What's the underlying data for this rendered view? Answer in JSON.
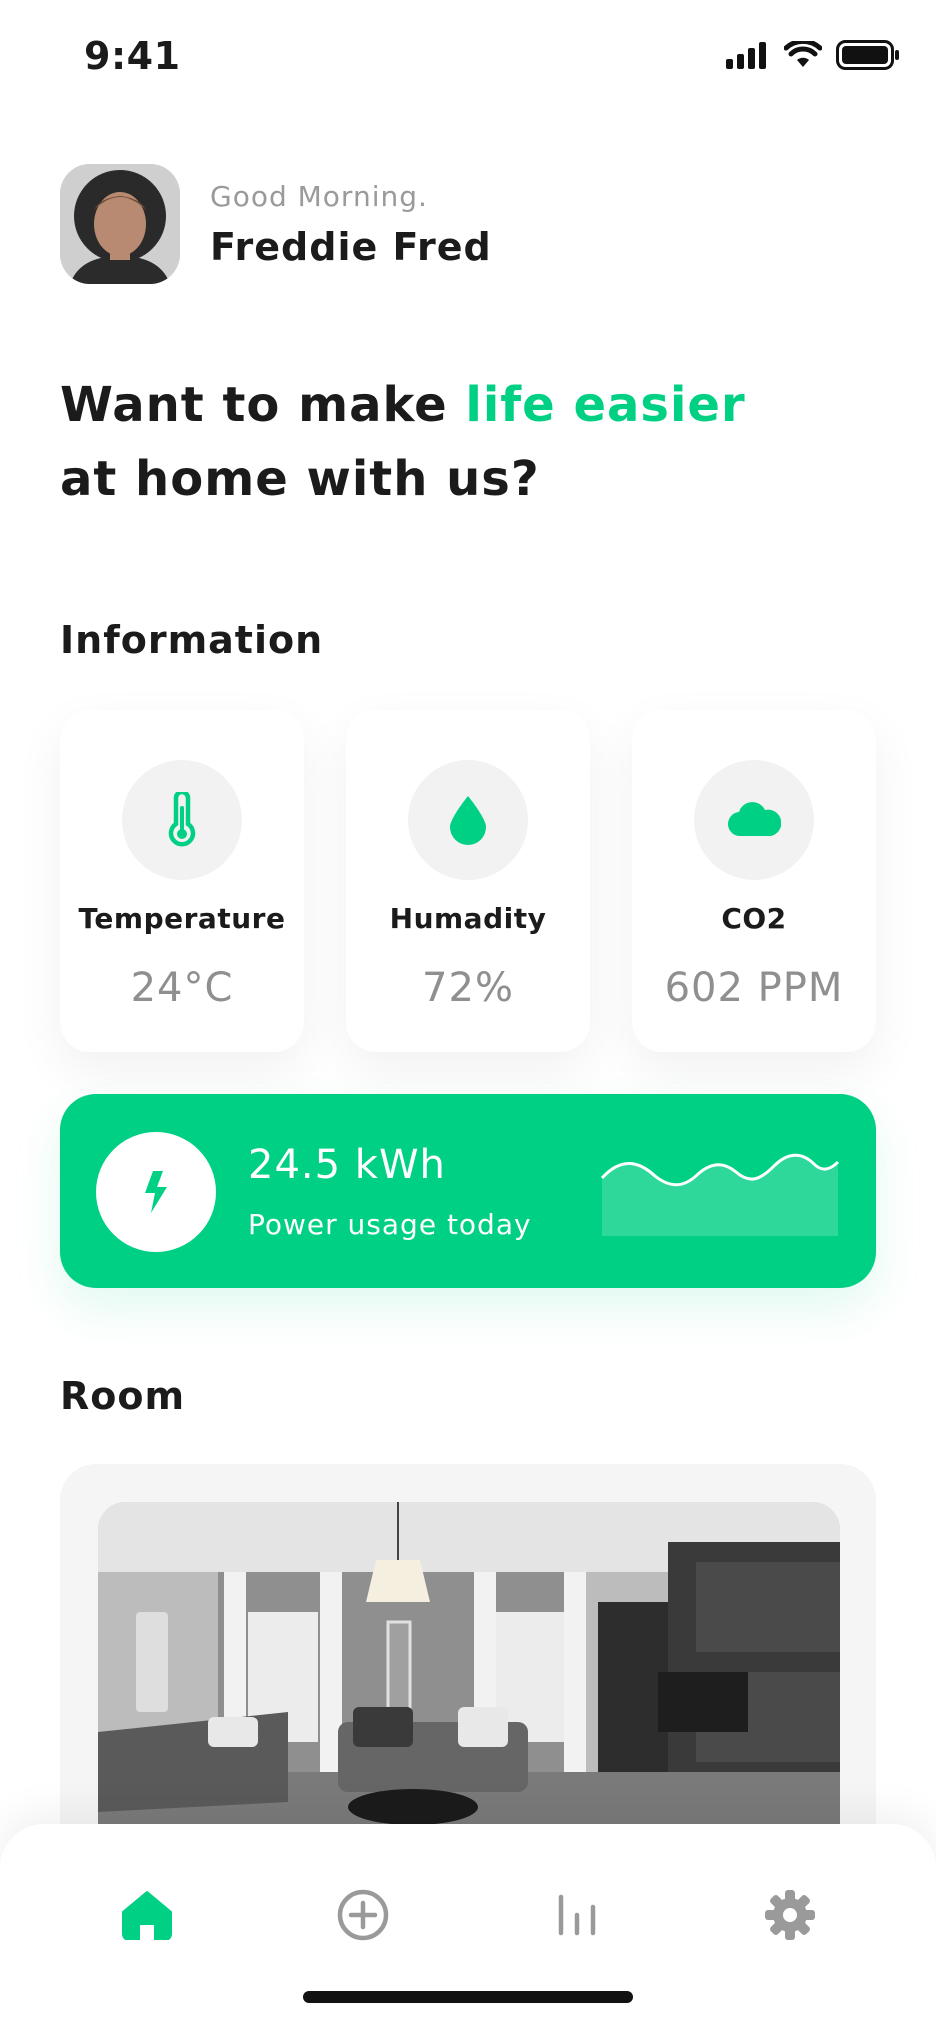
{
  "status_bar": {
    "time": "9:41"
  },
  "profile": {
    "greeting": "Good Morning.",
    "name": "Freddie Fred"
  },
  "headline": {
    "part1": "Want to make ",
    "accent": "life easier",
    "part2": "at home with us?"
  },
  "information": {
    "title": "Information",
    "cards": [
      {
        "label": "Temperature",
        "value": "24°C",
        "icon": "thermometer-icon"
      },
      {
        "label": "Humadity",
        "value": "72%",
        "icon": "water-drop-icon"
      },
      {
        "label": "CO2",
        "value": "602 PPM",
        "icon": "cloud-icon"
      }
    ]
  },
  "power": {
    "value": "24.5 kWh",
    "label": "Power usage today",
    "icon": "lightning-icon"
  },
  "room": {
    "title": "Room"
  },
  "nav": {
    "items": [
      {
        "name": "home",
        "icon": "home-icon",
        "active": true
      },
      {
        "name": "add",
        "icon": "add-circle-icon",
        "active": false
      },
      {
        "name": "stats",
        "icon": "bar-chart-icon",
        "active": false
      },
      {
        "name": "settings",
        "icon": "gear-icon",
        "active": false
      }
    ]
  },
  "colors": {
    "accent": "#00d084",
    "text": "#1b1b1b",
    "muted": "#8f8f8f",
    "inactive_icon": "#9a9a9a"
  }
}
